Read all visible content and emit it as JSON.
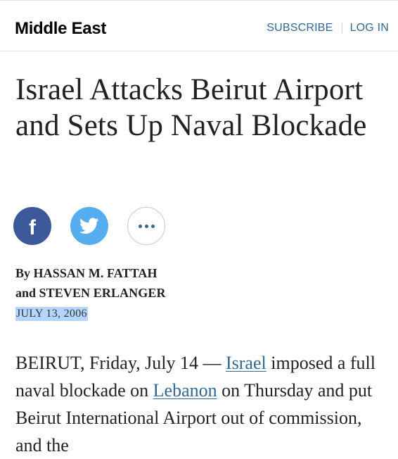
{
  "header": {
    "section_title": "Middle East",
    "subscribe_label": "SUBSCRIBE",
    "login_label": "LOG IN"
  },
  "article": {
    "headline": "Israel Attacks Beirut Airport and Sets Up Naval Blockade",
    "byline": {
      "prefix": "By",
      "author1": "HASSAN M. FATTAH",
      "conjunction": "and",
      "author2": "STEVEN ERLANGER"
    },
    "date": "JULY 13, 2006",
    "body": {
      "lead": "BEIRUT, Friday, July 14 — ",
      "link1": "Israel",
      "text1": " imposed a full naval blockade on ",
      "link2": "Lebanon",
      "text2": " on Thursday and put Beirut International Airport out of commission, and the"
    }
  },
  "share": {
    "facebook_icon": "facebook-icon",
    "twitter_icon": "twitter-icon",
    "more_icon": "more-dots-icon"
  },
  "colors": {
    "link": "#326891",
    "facebook": "#3b5998",
    "twitter": "#55acee",
    "selection_highlight": "#b4d5fe"
  }
}
